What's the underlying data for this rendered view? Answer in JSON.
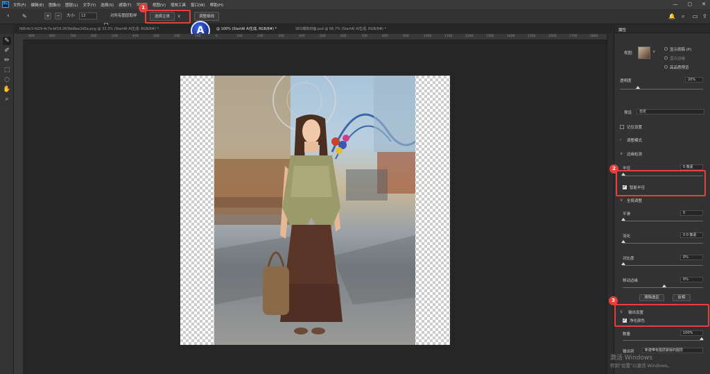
{
  "menubar": {
    "logo": "Ps",
    "items": [
      "文件(F)",
      "编辑(E)",
      "图像(I)",
      "图层(L)",
      "文字(Y)",
      "选择(S)",
      "滤镜(T)",
      "3D(D)",
      "视图(V)",
      "增效工具",
      "窗口(W)",
      "帮助(H)"
    ]
  },
  "window_controls": {
    "minimize": "—",
    "maximize": "▢",
    "close": "✕"
  },
  "options_bar": {
    "back_icon": "‹",
    "size_label": "大小:",
    "size_value": "13",
    "sample_all_label": "对所有图层取样",
    "select_subject": "选择主体",
    "select_subject_dropdown": "∨",
    "refine_hair": "调整细线"
  },
  "badges": {
    "one": "1",
    "two": "2",
    "three": "3"
  },
  "tabs": [
    {
      "label": "fb8c4c3-fd29-4c7e-bf19-263bb8ee2d0a.png @ 33.3% (StartAI AI生成, RGB/8#) *",
      "active": false
    },
    {
      "label": "@ 100% (StartAI AI生成, RGB/8#) *",
      "active": true
    },
    {
      "label": "SEO爆款封面.psd @ 66.7% (StartAI AI生成, RGB/8#) *",
      "active": false
    }
  ],
  "ruler_ticks": [
    "900",
    "800",
    "700",
    "600",
    "500",
    "400",
    "300",
    "200",
    "100",
    "0",
    "100",
    "200",
    "300",
    "400",
    "500",
    "600",
    "700",
    "800",
    "900",
    "1000",
    "1100",
    "1200",
    "1300",
    "1400",
    "1500",
    "1600",
    "1700",
    "1800"
  ],
  "panel": {
    "title": "属性",
    "view_label": "视图:",
    "show_edge": "显示原稿 (P)",
    "show_original": "显示边缘",
    "high_quality": "高品质预览",
    "opacity_label": "透明度",
    "opacity_value": "20%",
    "mode_label": "预设",
    "mode_value": "自定",
    "remember": "记住设置",
    "view_mode_section": "调整模式",
    "edge_detection_section": "边缘检测",
    "radius_label": "半径",
    "radius_value": "0 像素",
    "smart_radius": "智能半径",
    "global_section": "全局调整",
    "smooth_label": "平滑",
    "smooth_value": "0",
    "feather_label": "羽化",
    "feather_value": "0.0 像素",
    "contrast_label": "对比度",
    "contrast_value": "0%",
    "shift_edge_label": "移动边缘",
    "shift_edge_value": "0%",
    "clear_selection": "清除选区",
    "invert": "反相",
    "output_section": "输出设置",
    "decontaminate": "净化颜色",
    "amount_label": "数量",
    "amount_value": "100%",
    "output_to_label": "输出到",
    "output_to_value": "新建带有图层蒙版的图层"
  },
  "watermark": {
    "line1": "激活 Windows",
    "line2": "转到\"设置\"以激活 Windows。"
  },
  "colors": {
    "accent_red": "#e5413a",
    "panel_bg": "#323232",
    "canvas_bg": "#262626"
  }
}
